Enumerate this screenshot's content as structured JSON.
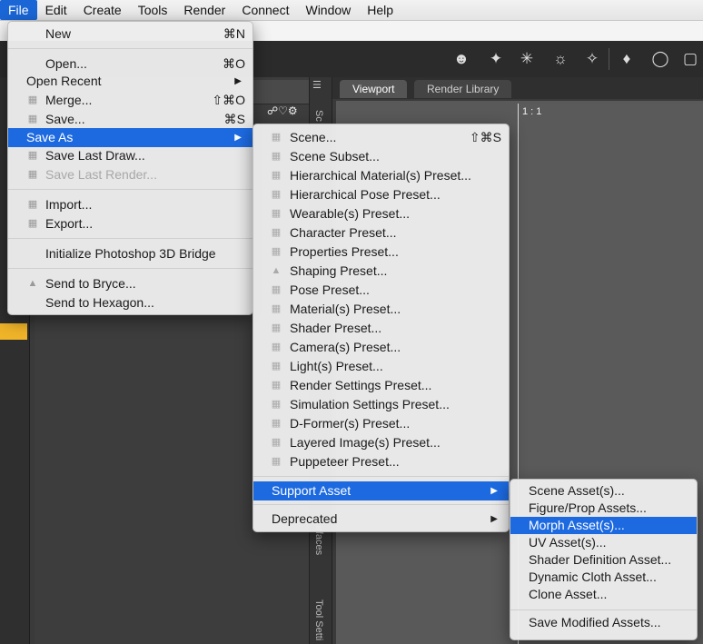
{
  "menubar": {
    "items": [
      "File",
      "Edit",
      "Create",
      "Tools",
      "Render",
      "Connect",
      "Window",
      "Help"
    ],
    "active": "File"
  },
  "panels": {
    "vertical_tabs": [
      "Sc",
      "urfaces",
      "Tool Setti"
    ],
    "viewport_tabs": [
      "Viewport",
      "Render Library"
    ],
    "aspect_label": "1 : 1"
  },
  "file_menu": {
    "items": [
      {
        "label": "New",
        "shortcut": "⌘N"
      },
      {
        "label": "Open...",
        "shortcut": "⌘O"
      },
      {
        "label": "Open Recent",
        "submenu": true
      },
      {
        "label": "Merge...",
        "shortcut": "⇧⌘O"
      },
      {
        "label": "Save...",
        "shortcut": "⌘S"
      },
      {
        "label": "Save As",
        "submenu": true
      },
      {
        "label": "Save Last Draw..."
      },
      {
        "label": "Save Last Render..."
      },
      {
        "label": "Import..."
      },
      {
        "label": "Export..."
      },
      {
        "label": "Initialize Photoshop 3D Bridge"
      },
      {
        "label": "Send to Bryce..."
      },
      {
        "label": "Send to Hexagon..."
      }
    ]
  },
  "save_as_menu": {
    "items": [
      {
        "label": "Scene...",
        "shortcut": "⇧⌘S"
      },
      {
        "label": "Scene Subset..."
      },
      {
        "label": "Hierarchical Material(s) Preset..."
      },
      {
        "label": "Hierarchical Pose Preset..."
      },
      {
        "label": "Wearable(s) Preset..."
      },
      {
        "label": "Character Preset..."
      },
      {
        "label": "Properties Preset..."
      },
      {
        "label": "Shaping Preset..."
      },
      {
        "label": "Pose Preset..."
      },
      {
        "label": "Material(s) Preset..."
      },
      {
        "label": "Shader Preset..."
      },
      {
        "label": "Camera(s) Preset..."
      },
      {
        "label": "Light(s) Preset..."
      },
      {
        "label": "Render Settings Preset..."
      },
      {
        "label": "Simulation Settings Preset..."
      },
      {
        "label": "D-Former(s) Preset..."
      },
      {
        "label": "Layered Image(s) Preset..."
      },
      {
        "label": "Puppeteer Preset..."
      },
      {
        "label": "Support Asset",
        "submenu": true
      },
      {
        "label": "Deprecated",
        "submenu": true
      }
    ]
  },
  "support_asset_menu": {
    "items": [
      {
        "label": "Scene Asset(s)..."
      },
      {
        "label": "Figure/Prop Assets..."
      },
      {
        "label": "Morph Asset(s)..."
      },
      {
        "label": "UV Asset(s)..."
      },
      {
        "label": "Shader Definition Asset..."
      },
      {
        "label": "Dynamic Cloth Asset..."
      },
      {
        "label": "Clone Asset..."
      },
      {
        "label": "Save Modified Assets..."
      }
    ]
  },
  "colors": {
    "selection": "#1d6ae0",
    "accent_tab": "#f0b429"
  }
}
